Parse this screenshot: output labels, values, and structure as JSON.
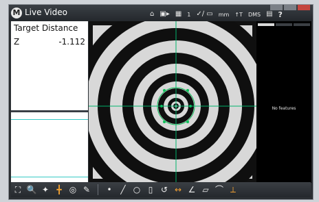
{
  "window": {
    "title": "Live Video",
    "logo": "M"
  },
  "toolbar": {
    "home_icon": "home-icon",
    "camera_icon": "video-camera-icon",
    "grid_icon": "grid-icon",
    "number": "1",
    "unit": "mm",
    "tt_label": "↑T",
    "dms_label": "DMS",
    "help_label": "?"
  },
  "dro": {
    "title": "Target Distance",
    "axis": "Z",
    "value": "-1.112"
  },
  "right_panel": {
    "empty_text": "No features"
  },
  "colors": {
    "crosshair": "#00b36b",
    "accent_cyan": "#35c9c5",
    "feature_green": "#0fbf5a"
  },
  "bottom_tools": [
    {
      "name": "probe-icon",
      "glyph": "⛶"
    },
    {
      "name": "magnify-icon",
      "glyph": "🔍"
    },
    {
      "name": "point-icon",
      "glyph": "✦"
    },
    {
      "name": "edge-icon",
      "glyph": "╋"
    },
    {
      "name": "circle-tool-icon",
      "glyph": "◎"
    },
    {
      "name": "pen-icon",
      "glyph": "✎"
    },
    {
      "name": "point-tool-icon",
      "glyph": "•"
    },
    {
      "name": "line-tool-icon",
      "glyph": "╱"
    },
    {
      "name": "circle-icon",
      "glyph": "○"
    },
    {
      "name": "slot-icon",
      "glyph": "▯"
    },
    {
      "name": "arc-icon",
      "glyph": "↺"
    },
    {
      "name": "distance-icon",
      "glyph": "↔"
    },
    {
      "name": "angle-icon",
      "glyph": "∠"
    },
    {
      "name": "parallelogram-icon",
      "glyph": "▱"
    },
    {
      "name": "curve-icon",
      "glyph": "⌒"
    },
    {
      "name": "datum-icon",
      "glyph": "⟂"
    }
  ]
}
